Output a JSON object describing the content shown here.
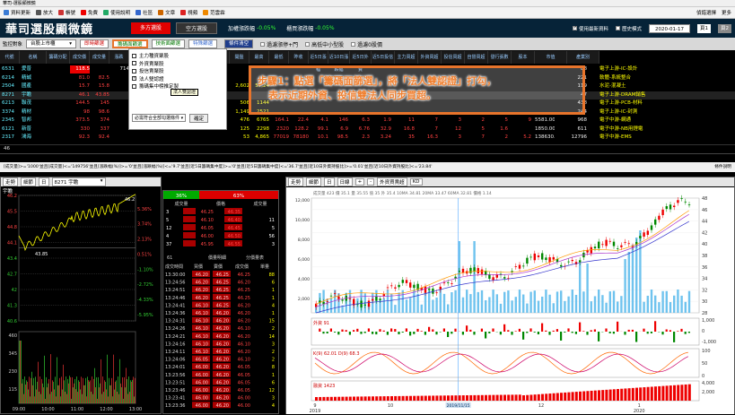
{
  "window": {
    "title": "華司-選股顯微鏡"
  },
  "toolbar": [
    {
      "icon": "home-icon",
      "label": "資料更新",
      "color": "#3a7bd5"
    },
    {
      "icon": "zoom-icon",
      "label": "放大",
      "color": "#555"
    },
    {
      "icon": "account-icon",
      "label": "帳號",
      "color": "#c33"
    },
    {
      "icon": "free-icon",
      "label": "免費",
      "color": "#e00"
    },
    {
      "icon": "help-icon",
      "label": "使用說明",
      "color": "#2a6"
    },
    {
      "icon": "forum-icon",
      "label": "社區",
      "color": "#36c"
    },
    {
      "icon": "article-icon",
      "label": "文章",
      "color": "#c60"
    },
    {
      "icon": "video-icon",
      "label": "視頻",
      "color": "#d22"
    },
    {
      "icon": "vip-icon",
      "label": "范雲霖",
      "color": "#e80"
    }
  ],
  "toolbar_right": {
    "settings": "偵錯選擇",
    "more": "更多"
  },
  "header": {
    "logo": "華司選股顯微鏡",
    "btn_long": "多方選股",
    "btn_short": "空方選股",
    "weighted_down": "加權漲跌幅",
    "weighted_value": "-0.05%",
    "otc_down": "櫃買漲跌幅",
    "otc_value": "-0.05%",
    "chk_latest": "使用最新資料",
    "chk_history": "歷史模式",
    "date": "2020-01-17",
    "page1": "頁1",
    "page2": "頁2"
  },
  "filterbar": {
    "group_label": "監控對象",
    "group_value": "台股上市櫃",
    "btn_instant": "即時篩選",
    "btn_chip": "籌碼面篩選",
    "btn_tech": "技術面篩選",
    "btn_special": "特殊篩選",
    "btn_cond": "條件清空",
    "chk_newhigh": "過濾漲停+門",
    "chk_trend": "高低中小型股",
    "chk_zero": "過濾0股價"
  },
  "grid": {
    "headers": [
      "代號",
      "名稱",
      "籌碼分配",
      "成交價",
      "成交量",
      "漲跌",
      "漲幅",
      "振幅",
      "內盤",
      "外盤",
      "成交值",
      "開盤",
      "最高",
      "最低",
      "昨收",
      "近5日漲幅",
      "近10日漲跌幅",
      "近5日外資",
      "近5日投信",
      "主力買超",
      "外資買超",
      "投信買超",
      "自營買超",
      "發行張數",
      "股本",
      "市值",
      "產業別"
    ],
    "rows": [
      {
        "code": "6531",
        "name": "愛普",
        "v": [
          "118.5",
          "",
          "714",
          "",
          "",
          "",
          "",
          "",
          "",
          "",
          "",
          "",
          "",
          "",
          "",
          "",
          "",
          "",
          "",
          "",
          "88",
          "電子上游-IC-設計"
        ]
      },
      {
        "code": "6214",
        "name": "精誠",
        "v": [
          "81.0",
          "82.5",
          "",
          "",
          "",
          "",
          "",
          "",
          "",
          "",
          "",
          "",
          "",
          "",
          "",
          "",
          "",
          "",
          "",
          "",
          "221",
          "軟體-系統整合"
        ]
      },
      {
        "code": "2504",
        "name": "國產",
        "v": [
          "15.7",
          "15.8",
          "",
          "2,602",
          "57,24",
          "",
          "",
          "",
          "",
          "",
          "",
          "",
          "",
          "",
          "",
          "",
          "",
          "",
          "",
          "",
          "119",
          "水泥-混凝土"
        ]
      },
      {
        "code": "8271",
        "name": "宇瞻",
        "v": [
          "46.1",
          "43.85",
          "",
          "",
          "",
          "",
          "",
          "",
          "",
          "",
          "",
          "",
          "",
          "",
          "",
          "",
          "",
          "",
          "",
          "",
          "47",
          "電子上游-DRAM銷售"
        ]
      },
      {
        "code": "6213",
        "name": "聯茂",
        "v": [
          "144.5",
          "145",
          "",
          "506",
          "1144",
          "",
          "",
          "",
          "",
          "",
          "",
          "",
          "",
          "",
          "",
          "",
          "",
          "",
          "",
          "",
          "438",
          "電子上游-PCB-材料"
        ]
      },
      {
        "code": "3374",
        "name": "精材",
        "v": [
          "98",
          "98.6",
          "",
          "1,149",
          "2521",
          "",
          "",
          "",
          "",
          "",
          "",
          "",
          "",
          "",
          "",
          "",
          "",
          "",
          "",
          "",
          "244",
          "電子上游-IC-封測"
        ]
      },
      {
        "code": "2345",
        "name": "智邦",
        "v": [
          "373.5",
          "374",
          "",
          "476",
          "6765",
          "164.1",
          "22.4",
          "4.1",
          "146",
          "6.3",
          "1.9",
          "11",
          "7",
          "3",
          "2",
          "5",
          "9",
          "5581.00",
          "",
          "",
          "968",
          "電子中游-網通"
        ]
      },
      {
        "code": "6121",
        "name": "新普",
        "v": [
          "330",
          "337",
          "",
          "125",
          "2298",
          "2320",
          "128.2",
          "99.1",
          "6.9",
          "6.76",
          "32.9",
          "16.8",
          "7",
          "12",
          "5",
          "1.6",
          "",
          "1850.00",
          "",
          "",
          "611",
          "電子中游-NB用鋰電"
        ]
      },
      {
        "code": "2317",
        "name": "鴻海",
        "v": [
          "92.3",
          "92.4",
          "",
          "53",
          "4,865",
          "77019",
          "78180",
          "10.1",
          "98.5",
          "2.3",
          "3.24",
          "35",
          "16.3",
          "3",
          "7",
          "2",
          "5.2",
          "138630.00",
          "",
          "",
          "12796",
          "電子中游-EMS"
        ]
      }
    ]
  },
  "dropdown": {
    "items": [
      {
        "label": "主力種資聚股",
        "checked": false
      },
      {
        "label": "外資賣聚股",
        "checked": false
      },
      {
        "label": "投信賣聚股",
        "checked": false
      },
      {
        "label": "法人雙認證",
        "checked": true
      },
      {
        "label": "籌碼集中榜推定製",
        "checked": false
      }
    ],
    "select_value": "必需符合全部勾選條件",
    "ok": "確定"
  },
  "tooltip": "法人雙認證",
  "callout": {
    "line1": "步驟1：點選「籌碼面篩選」，將「法人雙認證」打勾，",
    "line2": "表示近期外資、投信雙法人同步買超。"
  },
  "status_count": "46",
  "condbar": "[成交量]>='1000'並且[成交量]<='149756'並且[漲跌幅(%)]>='0'並且[漲跌幅(%)]<='9.7'並且[近5日籌碼集中度]>='0'並且[近5日籌碼集中度]<='36.7'並且[近10日外資持股比]>='0.01'並且[近10日外資持股比]<='23.84'",
  "condbar_right": "條件說明",
  "intraday": {
    "stock": "8271 宇瞻",
    "label": "宇瞻",
    "y_left": [
      "46.2",
      "45.5",
      "44.8",
      "44.1",
      "43.4",
      "42.7",
      "42",
      "41.3",
      "40.6"
    ],
    "y_right": [
      "5.36%",
      "3.74%",
      "2.13%",
      "0.51%",
      "-1.10%",
      "-2.72%",
      "-4.33%",
      "-5.95%"
    ],
    "low_label": "43.85",
    "high_label": "46.2",
    "xlabels": [
      "09:00",
      "10:00",
      "11:00",
      "12:00",
      "13:00"
    ],
    "vol_ticks": [
      "460",
      "345",
      "230",
      "115"
    ]
  },
  "ticks": {
    "buy_pct": "36%",
    "sell_pct": "63%",
    "hdr1": "成交量",
    "hdr2": "價格",
    "hdr3": "成交量",
    "book": [
      [
        "3",
        "",
        "46.25",
        "46.35",
        ""
      ],
      [
        "5",
        "",
        "46.10",
        "46.40",
        "11"
      ],
      [
        "12",
        "",
        "46.05",
        "46.45",
        "5"
      ],
      [
        "4",
        "",
        "46.00",
        "46.50",
        "56"
      ],
      [
        "37",
        "",
        "45.95",
        "46.55",
        "3"
      ]
    ],
    "tab1": "61",
    "tab2": "價量明細",
    "tab3": "分價量表",
    "time_hdr": [
      "成交時間",
      "買價",
      "賣價",
      "成交價",
      "單量"
    ],
    "rows": [
      [
        "13:30:00",
        "46.20",
        "46.25",
        "46.25",
        "88"
      ],
      [
        "13:24:56",
        "46.20",
        "46.25",
        "46.20",
        "6"
      ],
      [
        "13:24:51",
        "46.20",
        "46.25",
        "46.25",
        "1"
      ],
      [
        "13:24:46",
        "46.20",
        "46.25",
        "46.25",
        "1"
      ],
      [
        "13:24:41",
        "46.10",
        "46.25",
        "46.20",
        "4"
      ],
      [
        "13:24:36",
        "46.10",
        "46.20",
        "46.20",
        "1"
      ],
      [
        "13:24:31",
        "46.10",
        "46.20",
        "46.20",
        "15"
      ],
      [
        "13:24:26",
        "46.10",
        "46.20",
        "46.10",
        "2"
      ],
      [
        "13:24:21",
        "46.10",
        "46.20",
        "46.20",
        "14"
      ],
      [
        "13:24:16",
        "46.10",
        "46.20",
        "46.10",
        "3"
      ],
      [
        "13:24:11",
        "46.10",
        "46.20",
        "46.20",
        "2"
      ],
      [
        "13:24:06",
        "46.05",
        "46.20",
        "46.10",
        "2"
      ],
      [
        "13:24:01",
        "46.00",
        "46.20",
        "46.05",
        "8"
      ],
      [
        "13:23:56",
        "46.00",
        "46.20",
        "46.05",
        "1"
      ],
      [
        "13:23:51",
        "46.00",
        "46.20",
        "46.05",
        "6"
      ],
      [
        "13:23:46",
        "46.00",
        "46.20",
        "46.05",
        "12"
      ],
      [
        "13:23:41",
        "46.00",
        "46.20",
        "46.00",
        "3"
      ],
      [
        "13:23:36",
        "46.00",
        "46.20",
        "46.00",
        "4"
      ]
    ]
  },
  "kline": {
    "period": "日線",
    "mode": "外資買賣超",
    "indicator": "KD",
    "ma_legend": "成交量 423  價 35.1  量 35.55  值 35  外 35.4   10MA 34.81   20MA 33.47   60MA 32.81   價格 1.14",
    "price_ticks": [
      "48",
      "46",
      "44",
      "42",
      "40",
      "38",
      "36",
      "34",
      "32",
      "30",
      "28"
    ],
    "vol_ticks": [
      "12,000",
      "10,000",
      "8,000",
      "6,000",
      "4,000",
      "2,000"
    ],
    "foreign_label": "外資 91",
    "foreign_ticks": [
      "1,000",
      "0",
      "-1,000"
    ],
    "kd_label": "K(9) 62.01  D(9) 68.3",
    "kd_ticks": [
      "100",
      "50",
      "0"
    ],
    "margin_label": "融資 1423",
    "margin_ticks": [
      "4,000",
      "2,000"
    ],
    "x_months": [
      "9",
      "10",
      "11",
      "12",
      "1"
    ],
    "x_years": [
      "2019",
      "2020"
    ],
    "cursor_date": "2019/11/15"
  }
}
